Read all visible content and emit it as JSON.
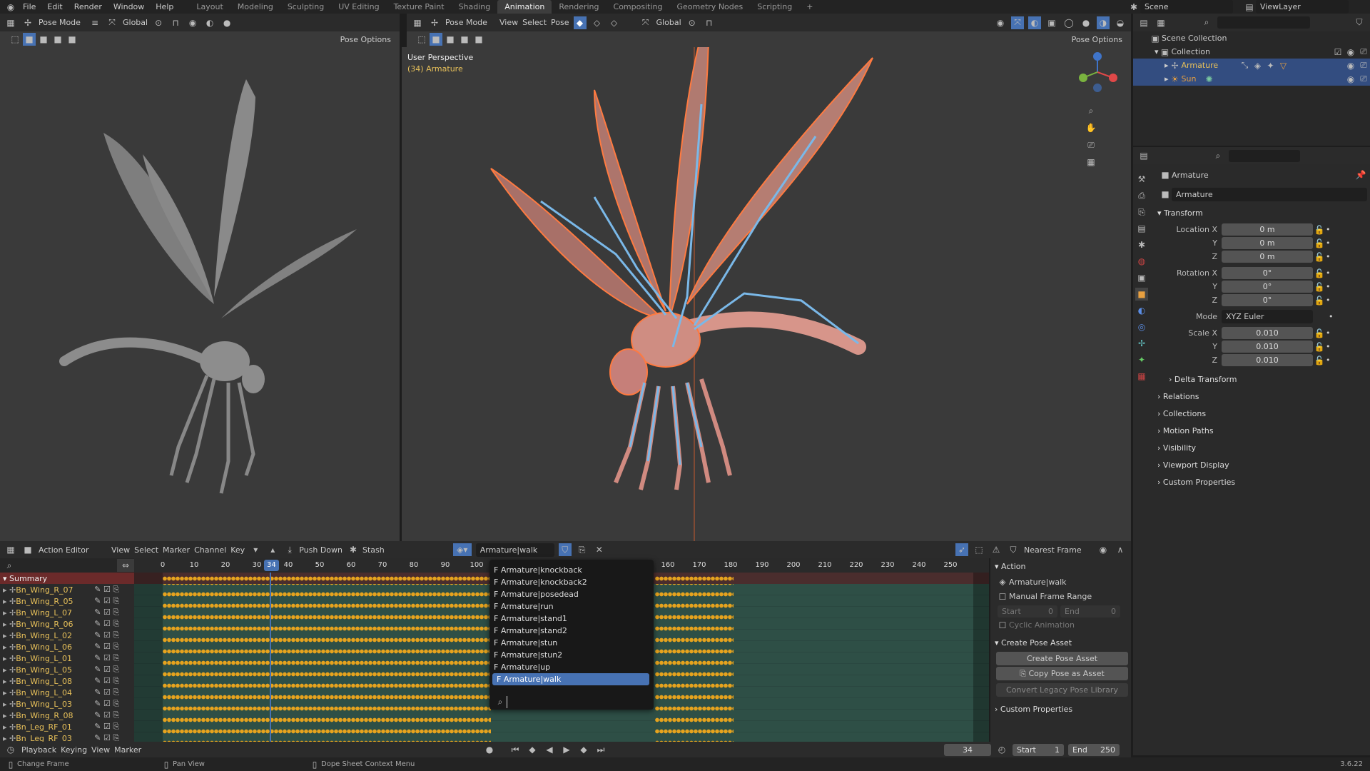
{
  "topbar": {
    "menus": [
      "File",
      "Edit",
      "Render",
      "Window",
      "Help"
    ],
    "workspaces": [
      "Layout",
      "Modeling",
      "Sculpting",
      "UV Editing",
      "Texture Paint",
      "Shading",
      "Animation",
      "Rendering",
      "Compositing",
      "Geometry Nodes",
      "Scripting",
      "+"
    ],
    "active_workspace": "Animation",
    "scene": "Scene",
    "view_layer": "ViewLayer"
  },
  "left_viewport": {
    "mode": "Pose Mode",
    "orientation": "Global",
    "pose_options": "Pose Options"
  },
  "main_viewport": {
    "mode": "Pose Mode",
    "menus": [
      "View",
      "Select",
      "Pose"
    ],
    "orientation": "Global",
    "pose_options": "Pose Options",
    "overlay_title": "User Perspective",
    "overlay_subtitle": "(34) Armature",
    "gizmo": {
      "z": "Z",
      "x": "X"
    }
  },
  "outliner": {
    "search_placeholder": "",
    "scene_collection": "Scene Collection",
    "collection": "Collection",
    "items": [
      {
        "name": "Armature",
        "color": "#e8c15a"
      },
      {
        "name": "Sun",
        "color": "#e8a040"
      }
    ]
  },
  "properties": {
    "object_name": "Armature",
    "datablock": "Armature",
    "transform_label": "Transform",
    "location": {
      "label": "Location X",
      "x": "0 m",
      "y": "0 m",
      "z": "0 m"
    },
    "rotation": {
      "label": "Rotation X",
      "x": "0°",
      "y": "0°",
      "z": "0°"
    },
    "mode_label": "Mode",
    "mode_value": "XYZ Euler",
    "scale": {
      "label": "Scale X",
      "x": "0.010",
      "y": "0.010",
      "z": "0.010"
    },
    "axis_y": "Y",
    "axis_z": "Z",
    "subsections": [
      "Delta Transform",
      "Relations",
      "Collections",
      "Motion Paths",
      "Visibility",
      "Viewport Display",
      "Custom Properties"
    ]
  },
  "dopesheet": {
    "editor_mode": "Action Editor",
    "menus": [
      "View",
      "Select",
      "Marker",
      "Channel",
      "Key"
    ],
    "push_down": "Push Down",
    "stash": "Stash",
    "action_name": "Armature|walk",
    "snap": "Nearest Frame",
    "current_frame": "34",
    "ticks": [
      "0",
      "10",
      "20",
      "30",
      "40",
      "50",
      "60",
      "70",
      "80",
      "90",
      "100",
      "160",
      "170",
      "180",
      "190",
      "200",
      "210",
      "220",
      "230",
      "240",
      "250"
    ],
    "summary": "Summary",
    "channels": [
      "Bn_Wing_R_07",
      "Bn_Wing_R_05",
      "Bn_Wing_L_07",
      "Bn_Wing_R_06",
      "Bn_Wing_L_02",
      "Bn_Wing_L_06",
      "Bn_Wing_L_01",
      "Bn_Wing_L_05",
      "Bn_Wing_L_08",
      "Bn_Wing_L_04",
      "Bn_Wing_L_03",
      "Bn_Wing_R_08",
      "Bn_Leg_RF_01",
      "Bn_Leg_RF_03"
    ]
  },
  "action_dropdown": {
    "items": [
      "F Armature|knockback",
      "F Armature|knockback2",
      "F Armature|posedead",
      "F Armature|run",
      "F Armature|stand1",
      "F Armature|stand2",
      "F Armature|stun",
      "F Armature|stun2",
      "F Armature|up",
      "F Armature|walk"
    ],
    "selected": "F Armature|walk"
  },
  "action_panel": {
    "action_header": "Action",
    "action_name": "Armature|walk",
    "manual_frame_range": "Manual Frame Range",
    "start_label": "Start",
    "start_value": "0",
    "end_label": "End",
    "end_value": "0",
    "cyclic": "Cyclic Animation",
    "pose_header": "Create Pose Asset",
    "create_pose_asset": "Create Pose Asset",
    "copy_pose": "Copy Pose as Asset",
    "convert_legacy": "Convert Legacy Pose Library",
    "custom_props": "Custom Properties"
  },
  "timeline": {
    "menus": [
      "Playback",
      "Keying",
      "View",
      "Marker"
    ],
    "frame": "34",
    "start_label": "Start",
    "start": "1",
    "end_label": "End",
    "end": "250"
  },
  "statusbar": {
    "change_frame": "Change Frame",
    "pan_view": "Pan View",
    "context_menu": "Dope Sheet Context Menu",
    "version": "3.6.22"
  }
}
